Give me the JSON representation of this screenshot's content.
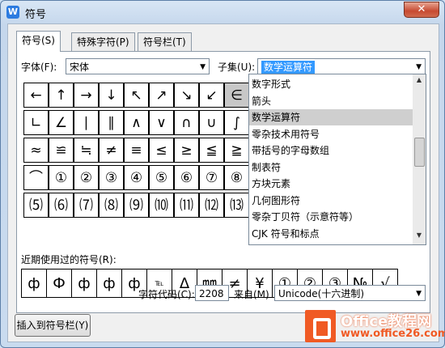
{
  "window": {
    "title": "符号",
    "app_icon": "W",
    "close": "✕"
  },
  "tabs": [
    "符号(S)",
    "特殊字符(P)",
    "符号栏(T)"
  ],
  "font": {
    "label": "字体(F):",
    "value": "宋体"
  },
  "subset": {
    "label": "子集(U):",
    "value": "数学运算符"
  },
  "grid": [
    [
      "←",
      "↑",
      "→",
      "↓",
      "↖",
      "↗",
      "↘",
      "↙",
      "∈"
    ],
    [
      "∟",
      "∠",
      "∣",
      "∥",
      "∧",
      "∨",
      "∩",
      "∪",
      "∫"
    ],
    [
      "≈",
      "≌",
      "≒",
      "≠",
      "≡",
      "≤",
      "≥",
      "≦",
      "≧"
    ],
    [
      "⌒",
      "①",
      "②",
      "③",
      "④",
      "⑤",
      "⑥",
      "⑦",
      "⑧"
    ],
    [
      "⑸",
      "⑹",
      "⑺",
      "⑻",
      "⑼",
      "⑽",
      "⑾",
      "⑿",
      "⒀"
    ]
  ],
  "dropdown_items": [
    "数字形式",
    "箭头",
    "数学运算符",
    "零杂技术用符号",
    "带括号的字母数组",
    "制表符",
    "方块元素",
    "几何图形符",
    "零杂丁贝符（示意符等）",
    "CJK 符号和标点"
  ],
  "dropdown_selected": 2,
  "recent": {
    "label": "近期使用过的符号(R):",
    "symbols": [
      "ф",
      "Ф",
      "ф",
      "ф",
      "ф",
      "℡",
      "Δ",
      "㎜",
      "≠",
      "¥",
      "①",
      "②",
      "③",
      "№",
      "√"
    ]
  },
  "char_code": {
    "label": "字符代码(C):",
    "value": "2208"
  },
  "from": {
    "label": "来自(M)",
    "value": "Unicode(十六进制)"
  },
  "insert_button": "插入到符号栏(Y)",
  "watermark": {
    "line1": "Office教程网",
    "line2": "www.office26.com"
  }
}
